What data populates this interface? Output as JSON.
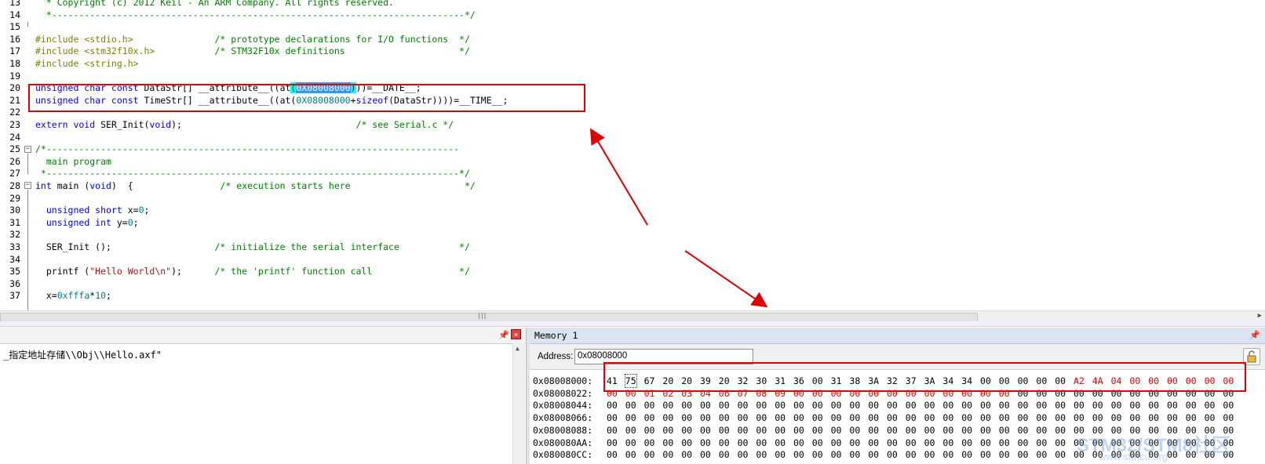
{
  "editor": {
    "lines": [
      {
        "n": "13",
        "parts": [
          {
            "c": "c-cm",
            "t": "  * Copyright (c) 2012 Keil - An ARM Company. All rights reserved."
          }
        ]
      },
      {
        "n": "14",
        "parts": [
          {
            "c": "c-cm",
            "t": "  *----------------------------------------------------------------------------*/"
          }
        ]
      },
      {
        "n": "15",
        "parts": []
      },
      {
        "n": "16",
        "parts": [
          {
            "c": "c-pp",
            "t": "#include "
          },
          {
            "c": "c-pp",
            "t": "<stdio.h>"
          },
          {
            "c": "c-df",
            "t": "               "
          },
          {
            "c": "c-cm",
            "t": "/* prototype declarations for I/O functions  */"
          }
        ]
      },
      {
        "n": "17",
        "parts": [
          {
            "c": "c-pp",
            "t": "#include "
          },
          {
            "c": "c-pp",
            "t": "<stm32f10x.h>"
          },
          {
            "c": "c-df",
            "t": "           "
          },
          {
            "c": "c-cm",
            "t": "/* STM32F10x definitions                     */"
          }
        ]
      },
      {
        "n": "18",
        "parts": [
          {
            "c": "c-pp",
            "t": "#include "
          },
          {
            "c": "c-pp",
            "t": "<string.h>"
          }
        ]
      },
      {
        "n": "19",
        "parts": []
      },
      {
        "n": "20",
        "parts": [
          {
            "c": "c-kw",
            "t": "unsigned char const "
          },
          {
            "c": "c-df",
            "t": "DataStr[] __attribute__((at"
          },
          {
            "c": "hl",
            "t": "("
          },
          {
            "c": "hlsel",
            "t": "0X08008000"
          },
          {
            "c": "hl",
            "t": ")"
          },
          {
            "c": "c-df",
            "t": "))=__DATE__;"
          }
        ]
      },
      {
        "n": "21",
        "parts": [
          {
            "c": "c-kw",
            "t": "unsigned char const "
          },
          {
            "c": "c-df",
            "t": "TimeStr[] __attribute__((at("
          },
          {
            "c": "c-nm",
            "t": "0X08008000"
          },
          {
            "c": "c-df",
            "t": "+"
          },
          {
            "c": "c-kw",
            "t": "sizeof"
          },
          {
            "c": "c-df",
            "t": "(DataStr))))=__TIME__;"
          }
        ]
      },
      {
        "n": "22",
        "parts": []
      },
      {
        "n": "23",
        "parts": [
          {
            "c": "c-kw",
            "t": "extern void "
          },
          {
            "c": "c-df",
            "t": "SER_Init("
          },
          {
            "c": "c-kw",
            "t": "void"
          },
          {
            "c": "c-df",
            "t": ");                                "
          },
          {
            "c": "c-cm",
            "t": "/* see Serial.c */"
          }
        ]
      },
      {
        "n": "24",
        "parts": []
      },
      {
        "n": "25",
        "parts": [
          {
            "c": "c-cm",
            "t": "/*----------------------------------------------------------------------------"
          }
        ]
      },
      {
        "n": "26",
        "parts": [
          {
            "c": "c-cm",
            "t": "  main program"
          }
        ]
      },
      {
        "n": "27",
        "parts": [
          {
            "c": "c-cm",
            "t": " *----------------------------------------------------------------------------*/"
          }
        ]
      },
      {
        "n": "28",
        "parts": [
          {
            "c": "c-kw",
            "t": "int "
          },
          {
            "c": "c-df",
            "t": "main ("
          },
          {
            "c": "c-kw",
            "t": "void"
          },
          {
            "c": "c-df",
            "t": ")  {                "
          },
          {
            "c": "c-cm",
            "t": "/* execution starts here                     */"
          }
        ]
      },
      {
        "n": "29",
        "parts": []
      },
      {
        "n": "30",
        "parts": [
          {
            "c": "c-df",
            "t": "  "
          },
          {
            "c": "c-kw",
            "t": "unsigned short "
          },
          {
            "c": "c-df",
            "t": "x="
          },
          {
            "c": "c-nm",
            "t": "0"
          },
          {
            "c": "c-df",
            "t": ";"
          }
        ]
      },
      {
        "n": "31",
        "parts": [
          {
            "c": "c-df",
            "t": "  "
          },
          {
            "c": "c-kw",
            "t": "unsigned int "
          },
          {
            "c": "c-df",
            "t": "y="
          },
          {
            "c": "c-nm",
            "t": "0"
          },
          {
            "c": "c-df",
            "t": ";"
          }
        ]
      },
      {
        "n": "32",
        "parts": []
      },
      {
        "n": "33",
        "parts": [
          {
            "c": "c-df",
            "t": "  SER_Init ();                   "
          },
          {
            "c": "c-cm",
            "t": "/* initialize the serial interface           */"
          }
        ]
      },
      {
        "n": "34",
        "parts": []
      },
      {
        "n": "35",
        "parts": [
          {
            "c": "c-df",
            "t": "  printf ("
          },
          {
            "c": "c-st",
            "t": "\"Hello World\\n\""
          },
          {
            "c": "c-df",
            "t": ");      "
          },
          {
            "c": "c-cm",
            "t": "/* the 'printf' function call                */"
          }
        ]
      },
      {
        "n": "36",
        "parts": []
      },
      {
        "n": "37",
        "parts": [
          {
            "c": "c-df",
            "t": "  x="
          },
          {
            "c": "c-nm",
            "t": "0xfffa"
          },
          {
            "c": "c-df",
            "t": "*"
          },
          {
            "c": "c-nm",
            "t": "10"
          },
          {
            "c": "c-df",
            "t": ";"
          }
        ]
      }
    ]
  },
  "output": {
    "text": "_指定地址存储\\\\Obj\\\\Hello.axf\""
  },
  "memory": {
    "title": "Memory 1",
    "address_label": "Address:",
    "address_value": "0x08008000",
    "rows": [
      {
        "addr": "0x08008000:",
        "bytes": [
          "41",
          "75",
          "67",
          "20",
          "20",
          "39",
          "20",
          "32",
          "30",
          "31",
          "36",
          "00",
          "31",
          "38",
          "3A",
          "32",
          "37",
          "3A",
          "34",
          "34",
          "00",
          "00",
          "00",
          "00",
          "00",
          "A2",
          "4A",
          "04",
          "00",
          "00",
          "00",
          "00",
          "00",
          "00"
        ],
        "red": [
          25,
          26,
          27,
          28,
          29,
          30,
          31,
          32,
          33
        ]
      },
      {
        "addr": "0x08008022:",
        "bytes": [
          "00",
          "00",
          "01",
          "02",
          "03",
          "04",
          "06",
          "07",
          "08",
          "09",
          "00",
          "00",
          "00",
          "00",
          "00",
          "00",
          "00",
          "00",
          "00",
          "00",
          "00",
          "00",
          "00",
          "00",
          "00",
          "00",
          "00",
          "00",
          "00",
          "00",
          "00",
          "00",
          "00",
          "00"
        ],
        "red": [
          0,
          1,
          2,
          3,
          4,
          5,
          6,
          7,
          8,
          9,
          10,
          11,
          12,
          13,
          14,
          15,
          16,
          17,
          18,
          19,
          20,
          21
        ]
      },
      {
        "addr": "0x08008044:",
        "bytes": [
          "00",
          "00",
          "00",
          "00",
          "00",
          "00",
          "00",
          "00",
          "00",
          "00",
          "00",
          "00",
          "00",
          "00",
          "00",
          "00",
          "00",
          "00",
          "00",
          "00",
          "00",
          "00",
          "00",
          "00",
          "00",
          "00",
          "00",
          "00",
          "00",
          "00",
          "00",
          "00",
          "00",
          "00"
        ],
        "red": []
      },
      {
        "addr": "0x08008066:",
        "bytes": [
          "00",
          "00",
          "00",
          "00",
          "00",
          "00",
          "00",
          "00",
          "00",
          "00",
          "00",
          "00",
          "00",
          "00",
          "00",
          "00",
          "00",
          "00",
          "00",
          "00",
          "00",
          "00",
          "00",
          "00",
          "00",
          "00",
          "00",
          "00",
          "00",
          "00",
          "00",
          "00",
          "00",
          "00"
        ],
        "red": []
      },
      {
        "addr": "0x08008088:",
        "bytes": [
          "00",
          "00",
          "00",
          "00",
          "00",
          "00",
          "00",
          "00",
          "00",
          "00",
          "00",
          "00",
          "00",
          "00",
          "00",
          "00",
          "00",
          "00",
          "00",
          "00",
          "00",
          "00",
          "00",
          "00",
          "00",
          "00",
          "00",
          "00",
          "00",
          "00",
          "00",
          "00",
          "00",
          "00"
        ],
        "red": []
      },
      {
        "addr": "0x080080AA:",
        "bytes": [
          "00",
          "00",
          "00",
          "00",
          "00",
          "00",
          "00",
          "00",
          "00",
          "00",
          "00",
          "00",
          "00",
          "00",
          "00",
          "00",
          "00",
          "00",
          "00",
          "00",
          "00",
          "00",
          "00",
          "00",
          "00",
          "00",
          "00",
          "00",
          "00",
          "00",
          "00",
          "00",
          "00",
          "00"
        ],
        "red": []
      },
      {
        "addr": "0x080080CC:",
        "bytes": [
          "00",
          "00",
          "00",
          "00",
          "00",
          "00",
          "00",
          "00",
          "00",
          "00",
          "00",
          "00",
          "00",
          "00",
          "00",
          "00",
          "00",
          "00",
          "00",
          "00",
          "00",
          "00",
          "00",
          "00",
          "00",
          "00",
          "00",
          "00",
          "00",
          "00",
          "00",
          "00",
          "00",
          "00"
        ],
        "red": []
      }
    ]
  },
  "watermark": {
    "main": "STM32/STM8社区",
    "sub": "www.stmcu.org"
  },
  "colors": {
    "annotation_red": "#e00000"
  }
}
